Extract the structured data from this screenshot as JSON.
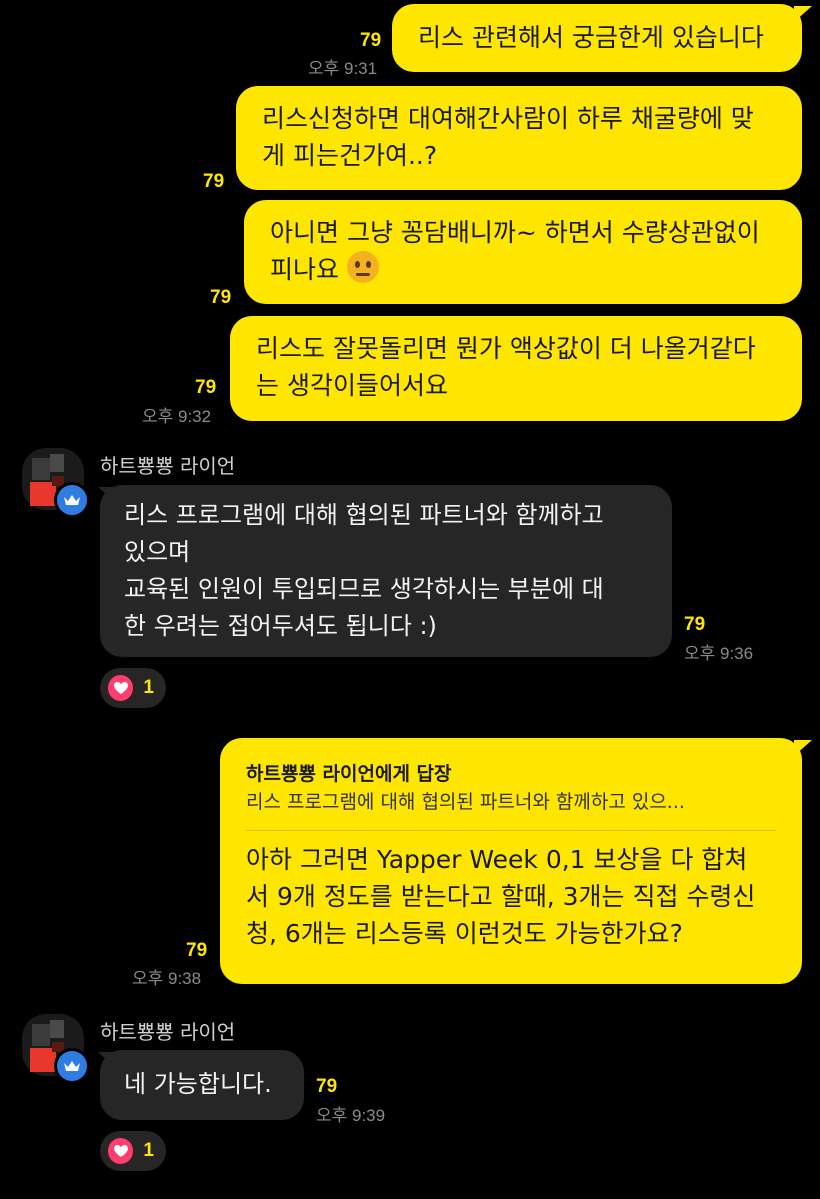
{
  "messages_sent_1": {
    "m1": "리스 관련해서 궁금한게 있습니다",
    "m1_unread": "79",
    "m2_line1": "리스신청하면 대여해간사람이 하루 채굴량에 맞",
    "m2_line2": "게 피는건가여..?",
    "m2_unread": "79",
    "m3_line1": "아니면 그냥 꽁담배니까~ 하면서 수량상관없이",
    "m3_line2": "피나요",
    "m3_emoji": "🤔",
    "m3_unread": "79",
    "m4_line1": "리스도 잘못돌리면 뭔가 액상값이 더 나올거같다",
    "m4_line2": "는 생각이들어서요",
    "m4_unread": "79",
    "time_a": "오후 9:31",
    "time_b": "오후 9:32"
  },
  "reply_1": {
    "sender": "하트뿅뿅 라이언",
    "line1": "리스 프로그램에 대해 협의된 파트너와 함께하고",
    "line2": "있으며",
    "line3": "교육된 인원이 투입되므로 생각하시는 부분에 대",
    "line4": "한 우려는 접어두셔도 됩니다 :)",
    "unread": "79",
    "time": "오후 9:36",
    "reaction_count": "1"
  },
  "sent_reply": {
    "reply_to": "하트뿅뿅 라이언에게 답장",
    "quote": "리스 프로그램에 대해 협의된 파트너와 함께하고 있으...",
    "line1": "아하 그러면 Yapper Week 0,1 보상을 다 합쳐",
    "line2": "서 9개 정도를 받는다고 할때, 3개는 직접 수령신",
    "line3": "청, 6개는 리스등록 이런것도 가능한가요?",
    "unread": "79",
    "time": "오후 9:38"
  },
  "reply_2": {
    "sender": "하트뿅뿅 라이언",
    "text": "네 가능합니다.",
    "unread": "79",
    "time": "오후 9:39",
    "reaction_count": "1"
  },
  "colors": {
    "my_bubble": "#ffe600",
    "their_bubble": "#262626",
    "background": "#000000",
    "unread": "#ffe600",
    "heart": "#ff3d6e",
    "badge": "#2f7de1"
  },
  "icons": [
    "crown-badge-icon",
    "heart-icon",
    "thinking-face-emoji"
  ]
}
